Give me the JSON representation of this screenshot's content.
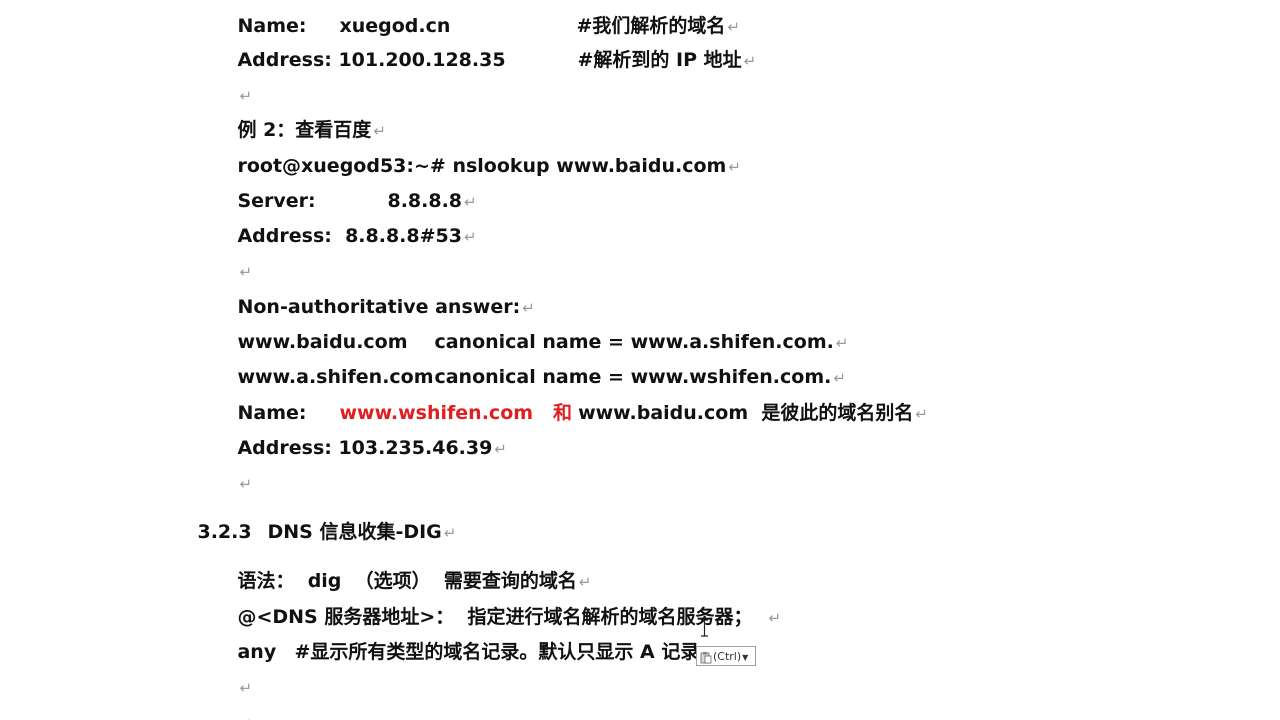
{
  "mark": "↵",
  "doc": {
    "top_line": {
      "label": "Name:",
      "value": "xuegod.cn",
      "comment": "#我们解析的域名"
    },
    "address_line": {
      "label": "Address: 101.200.128.35",
      "comment": "#解析到的 IP 地址"
    },
    "example2": {
      "title": "例 2：查看百度",
      "command": "root@xuegod53:~# nslookup www.baidu.com",
      "server_label": "Server:",
      "server_value": "8.8.8.8",
      "server_address": "Address:  8.8.8.8#53",
      "non_auth": "Non-authoritative answer:",
      "cname_rows": [
        {
          "host": "www.baidu.com",
          "rest": "canonical name = www.a.shifen.com."
        },
        {
          "host": "www.a.shifen.com",
          "rest": "canonical name = www.wshifen.com."
        }
      ],
      "name_label": "Name:",
      "name_red_1": "www.wshifen.com",
      "name_red_2": "和",
      "name_rest": "www.baidu.com  是彼此的域名别名",
      "final_address": "Address: 103.235.46.39"
    },
    "section": {
      "number": "3.2.3",
      "title": "DNS 信息收集-DIG"
    },
    "syntax": {
      "line1": "语法：  dig  （选项）  需要查询的域名",
      "line2": "@<DNS 服务器地址>：  指定进行域名解析的域名服务器；",
      "any_label": "any",
      "any_desc": "#显示所有类型的域名记录。默认只显示 A 记录"
    }
  },
  "paste_options": {
    "label": "(Ctrl)"
  },
  "colors": {
    "text": "#111111",
    "highlight_red": "#e02020",
    "paragraph_mark": "#9a9a9a"
  }
}
